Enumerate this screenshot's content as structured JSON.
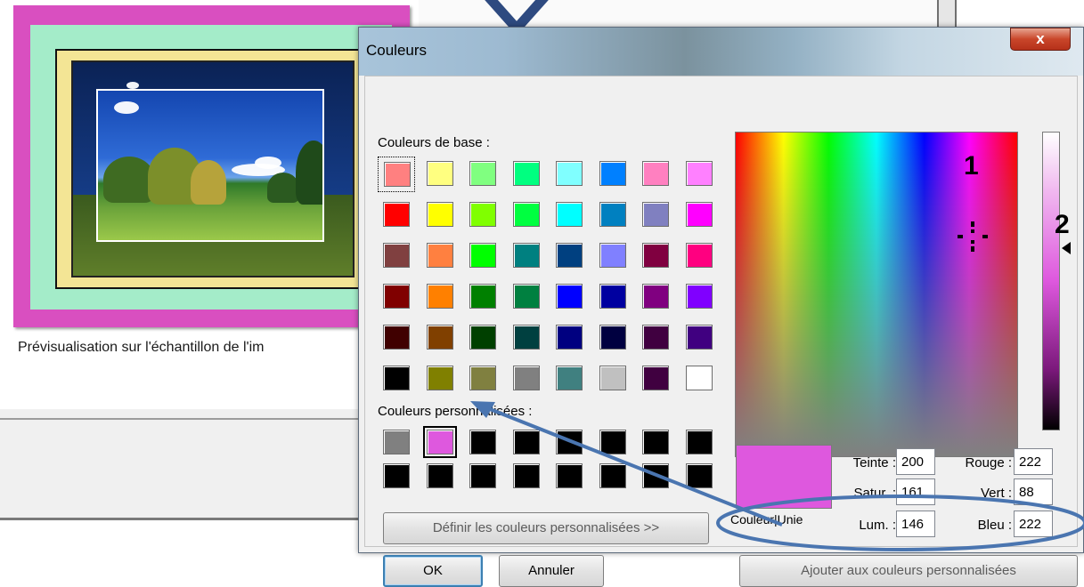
{
  "background_window": {
    "preview_caption": "Prévisualisation sur l'échantillon de l'im"
  },
  "dialog": {
    "title": "Couleurs",
    "close_label": "x",
    "base_colors_label": "Couleurs de base :",
    "custom_colors_label": "Couleurs personnalisées :",
    "base_colors": [
      [
        "#ff8080",
        "#ffff80",
        "#80ff80",
        "#00ff80",
        "#80ffff",
        "#0080ff",
        "#ff80c0",
        "#ff80ff"
      ],
      [
        "#ff0000",
        "#ffff00",
        "#80ff00",
        "#00ff40",
        "#00ffff",
        "#0080c0",
        "#8080c0",
        "#ff00ff"
      ],
      [
        "#804040",
        "#ff8040",
        "#00ff00",
        "#008080",
        "#004080",
        "#8080ff",
        "#800040",
        "#ff0080"
      ],
      [
        "#800000",
        "#ff8000",
        "#008000",
        "#008040",
        "#0000ff",
        "#0000a0",
        "#800080",
        "#8000ff"
      ],
      [
        "#400000",
        "#804000",
        "#004000",
        "#004040",
        "#000080",
        "#000040",
        "#400040",
        "#400080"
      ],
      [
        "#000000",
        "#808000",
        "#808040",
        "#808080",
        "#408080",
        "#c0c0c0",
        "#400040",
        "#ffffff"
      ]
    ],
    "custom_colors": [
      [
        "#808080",
        "#de58de",
        "#000000",
        "#000000",
        "#000000",
        "#000000",
        "#000000",
        "#000000"
      ],
      [
        "#000000",
        "#000000",
        "#000000",
        "#000000",
        "#000000",
        "#000000",
        "#000000",
        "#000000"
      ]
    ],
    "selected_color": "#de58de",
    "solid_color_label": "Couleur|Unie",
    "fields": {
      "hue_label": "Teinte :",
      "hue": "200",
      "sat_label": "Satur. :",
      "sat": "161",
      "lum_label": "Lum. :",
      "lum": "146",
      "red_label": "Rouge :",
      "red": "222",
      "green_label": "Vert :",
      "green": "88",
      "blue_label": "Bleu :",
      "blue": "222"
    },
    "buttons": {
      "define": "Définir les couleurs personnalisées >>",
      "ok": "OK",
      "cancel": "Annuler",
      "add": "Ajouter aux couleurs personnalisées"
    },
    "markers": {
      "spectrum": "1",
      "luminosity": "2"
    }
  },
  "annotation_color": "#4a75b0"
}
